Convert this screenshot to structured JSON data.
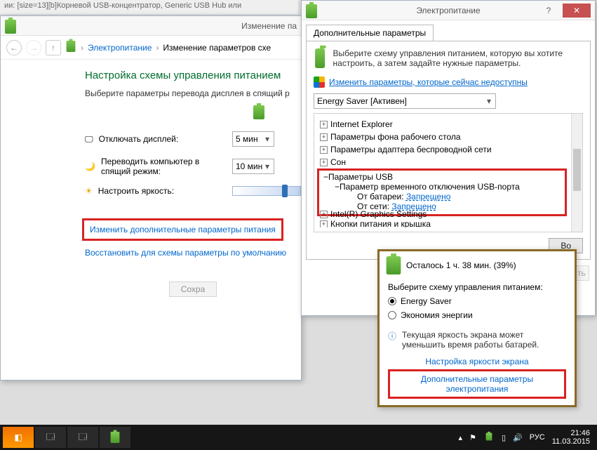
{
  "strip_text": "ии: [size=13][b]Корневой USB-концентратор, Generic USB Hub или",
  "back": {
    "title": "Изменение па",
    "breadcrumb1": "Электропитание",
    "breadcrumb2": "Изменение параметров схе",
    "heading": "Настройка схемы управления питанием",
    "subtext": "Выберите параметры перевода дисплея в спящий р",
    "row_display_off": "Отключать дисплей:",
    "row_display_off_val": "5 мин",
    "row_sleep": "Переводить компьютер в спящий режим:",
    "row_sleep_val": "10 мин",
    "row_brightness": "Настроить яркость:",
    "link_advanced": "Изменить дополнительные параметры питания",
    "link_restore": "Восстановить для схемы параметры по умолчанию",
    "save_btn": "Сохра"
  },
  "dlg": {
    "title": "Электропитание",
    "tab": "Дополнительные параметры",
    "intro": "Выберите схему управления питанием, которую вы хотите настроить, а затем задайте нужные параметры.",
    "uac_link": "Изменить параметры, которые сейчас недоступны",
    "plan": "Energy Saver [Активен]",
    "tree": {
      "ie": "Internet Explorer",
      "wallpaper": "Параметры фона рабочего стола",
      "wifi": "Параметры адаптера беспроводной сети",
      "sleep": "Сон",
      "usb": "Параметры USB",
      "usb_suspend": "Параметр временного отключения USB-порта",
      "on_battery": "От батареи:",
      "on_battery_val": "Запрещено",
      "on_ac": "От сети:",
      "on_ac_val": "Запрещено",
      "intel": "Intel(R) Graphics Settings",
      "lid": "Кнопки питания и крышка"
    },
    "restore_btn": "Во",
    "ok": "ть"
  },
  "popup": {
    "status": "Осталось 1 ч. 38 мин. (39%)",
    "choose": "Выберите схему управления питанием:",
    "opt1": "Energy Saver",
    "opt2": "Экономия энергии",
    "note": "Текущая яркость экрана может уменьшить время работы батарей.",
    "link1": "Настройка яркости экрана",
    "link2": "Дополнительные параметры электропитания"
  },
  "taskbar": {
    "lang": "РУС",
    "time": "21:46",
    "date": "11.03.2015"
  }
}
